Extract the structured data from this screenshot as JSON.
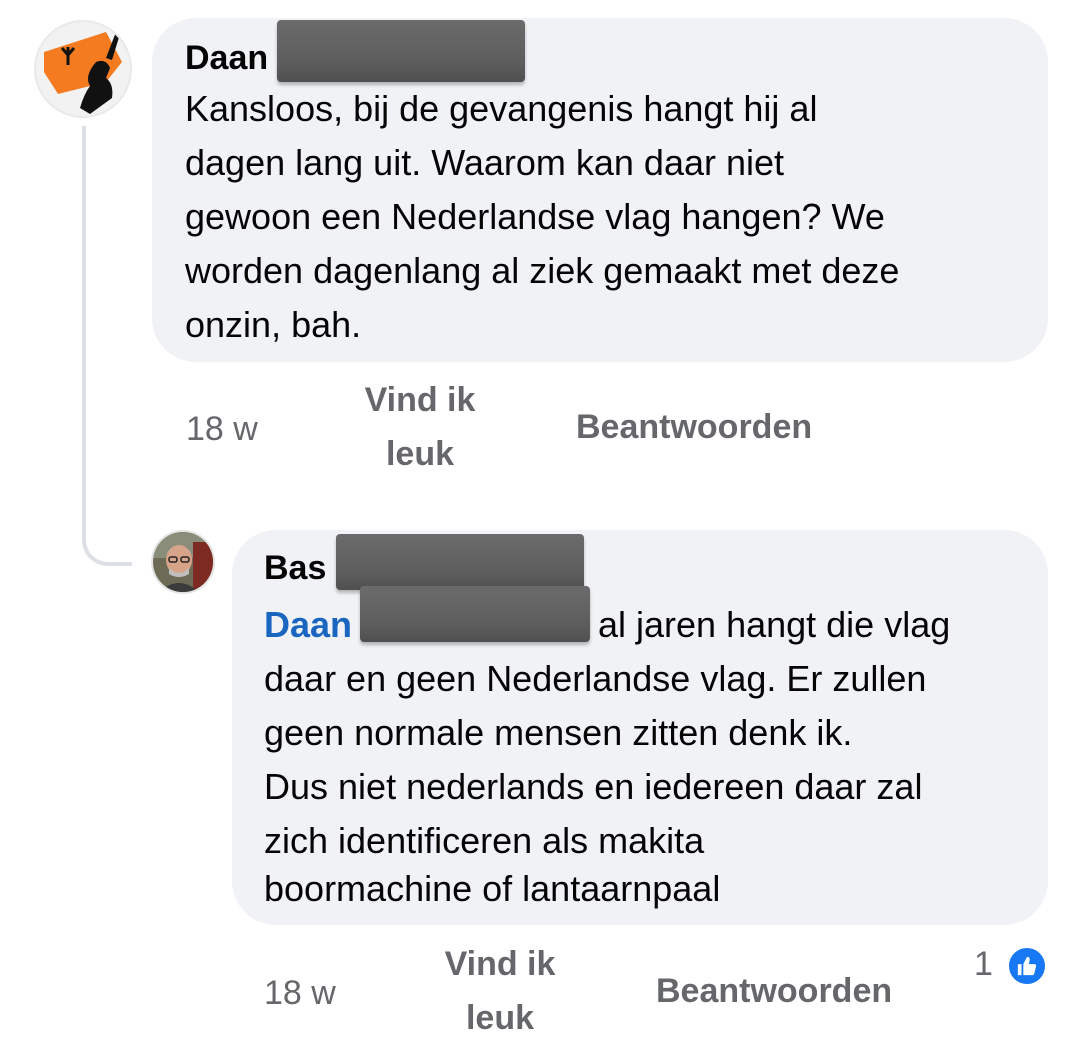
{
  "comments": [
    {
      "author": "Daan",
      "lines": [
        "Kansloos, bij de gevangenis hangt hij al",
        "dagen lang uit. Waarom kan daar niet",
        "gewoon een Nederlandse vlag hangen? We",
        "worden dagenlang al ziek gemaakt met deze",
        "onzin, bah."
      ],
      "time": "18 w",
      "like_line1": "Vind ik",
      "like_line2": "leuk",
      "reply": "Beantwoorden"
    },
    {
      "author": "Bas",
      "mention": "Daan",
      "first_line_rest": "al jaren hangt die vlag",
      "lines": [
        "daar en geen Nederlandse vlag. Er zullen",
        "geen normale mensen zitten denk ik.",
        "Dus niet nederlands en iedereen daar zal",
        "zich identificeren als makita",
        "boormachine of lantaarnpaal"
      ],
      "time": "18 w",
      "like_line1": "Vind ik",
      "like_line2": "leuk",
      "reply": "Beantwoorden",
      "reaction_count": "1"
    }
  ],
  "icons": {
    "reaction": "thumbs-up-icon",
    "reaction_color": "#1877f2",
    "mention_color": "#1a65c0"
  }
}
